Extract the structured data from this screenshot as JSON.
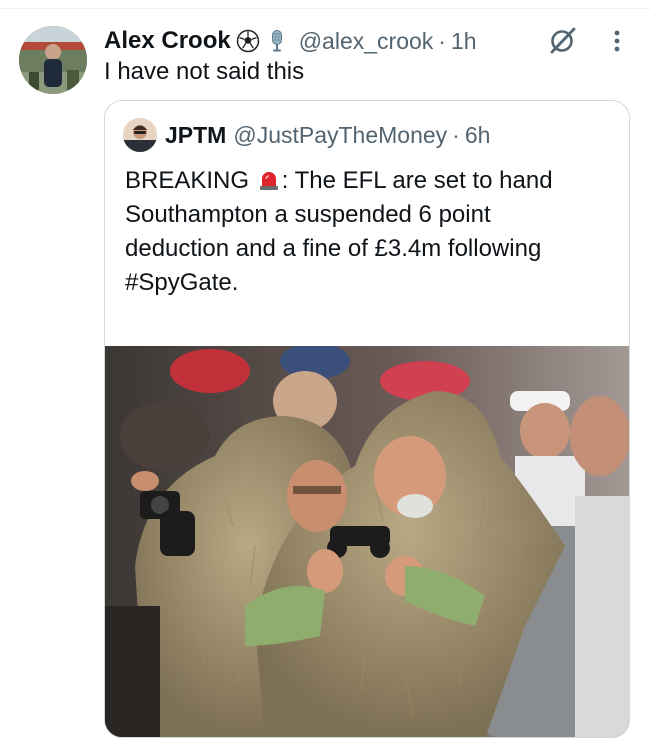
{
  "tweet": {
    "author_name": "Alex Crook",
    "author_emojis": [
      "soccer-ball-icon",
      "microphone-icon"
    ],
    "handle": "@alex_crook",
    "separator": "·",
    "time": "1h",
    "text": "I have not said this"
  },
  "quote": {
    "author_name": "JPTM",
    "handle": "@JustPayTheMoney",
    "separator": "·",
    "time": "6h",
    "line1_before": "BREAKING",
    "line1_after": ": The EFL are set to hand",
    "line2": "Southampton a suspended 6 point",
    "line3": "deduction and a fine of £3.4m following",
    "line4": "#SpyGate.",
    "more": "...",
    "image_icon": "siren-icon"
  },
  "colors": {
    "text": "#0f1419",
    "secondary": "#536471",
    "border": "#cfd9de",
    "siren": "#e0242c"
  }
}
